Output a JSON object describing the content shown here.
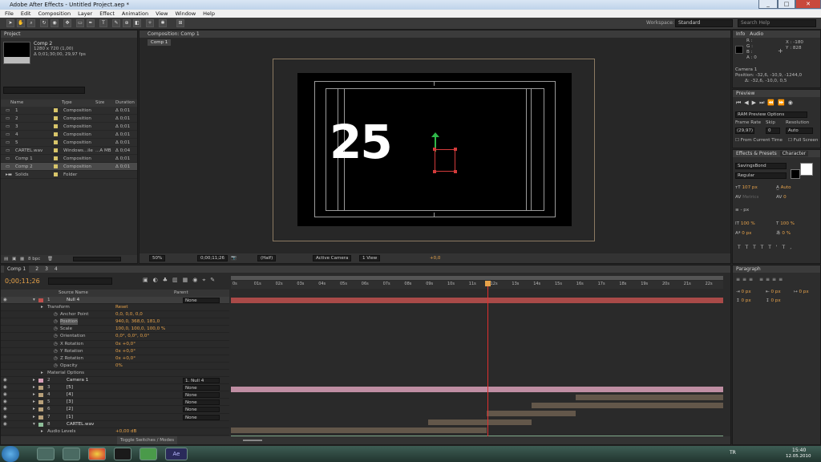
{
  "titlebar": {
    "title": "Adobe After Effects - Untitled Project.aep *"
  },
  "menu": [
    "File",
    "Edit",
    "Composition",
    "Layer",
    "Effect",
    "Animation",
    "View",
    "Window",
    "Help"
  ],
  "toolbar": {
    "workspace_label": "Workspace:",
    "workspace_value": "Standard",
    "search_placeholder": "Search Help"
  },
  "project": {
    "tab": "Project",
    "comp_name": "Comp 2",
    "comp_info_1": "1280 x 720 (1,00)",
    "comp_info_2": "Δ 0;01;30;00, 29,97 fps",
    "headers": [
      "Name",
      "Type",
      "Size",
      "Duration"
    ],
    "items": [
      {
        "name": "1",
        "type": "Composition",
        "size": "",
        "duration": "Δ 0;01"
      },
      {
        "name": "2",
        "type": "Composition",
        "size": "",
        "duration": "Δ 0;01"
      },
      {
        "name": "3",
        "type": "Composition",
        "size": "",
        "duration": "Δ 0;01"
      },
      {
        "name": "4",
        "type": "Composition",
        "size": "",
        "duration": "Δ 0;01"
      },
      {
        "name": "5",
        "type": "Composition",
        "size": "",
        "duration": "Δ 0;01"
      },
      {
        "name": "CARTEL.wav",
        "type": "Windows...ile",
        "size": "...A MB",
        "duration": "Δ 0;04"
      },
      {
        "name": "Comp 1",
        "type": "Composition",
        "size": "",
        "duration": "Δ 0;01"
      },
      {
        "name": "Comp 2",
        "type": "Composition",
        "size": "",
        "duration": "Δ 0;01"
      },
      {
        "name": "Solids",
        "type": "Folder",
        "size": "",
        "duration": ""
      }
    ],
    "bpc": "8 bpc"
  },
  "comp": {
    "tab": "Composition: Comp 1",
    "subtab": "Comp 1",
    "number_text": "25",
    "zoom": "50%",
    "time": "0;00;11;26",
    "resolution": "(Half)",
    "camera": "Active Camera",
    "views": "1 View",
    "exposure": "+0,0"
  },
  "info": {
    "tab1": "Info",
    "tab2": "Audio",
    "r": "R :",
    "g": "G :",
    "b": "B :",
    "a": "A : 0",
    "x": "X : -180",
    "y": "Y : 828",
    "camera": "Camera 1",
    "position": "Position: -32,6, -10,9, -1244,0",
    "delta": "Δ: -32,6, -10,0, 0,5"
  },
  "preview": {
    "tab": "Preview",
    "ram": "RAM Preview Options",
    "frame_rate_label": "Frame Rate",
    "skip_label": "Skip",
    "resolution_label": "Resolution",
    "frame_rate": "(29,97)",
    "skip": "0",
    "resolution": "Auto",
    "from_current": "From Current Time",
    "full_screen": "Full Screen"
  },
  "character": {
    "tab1": "Effects & Presets",
    "tab2": "Character",
    "font": "SavingsBond",
    "style": "Regular",
    "size": "107 px",
    "leading": "Auto",
    "kerning": "Metrics",
    "tracking": "0",
    "stroke": "- px",
    "vscale": "100 %",
    "hscale": "100 %",
    "baseline": "0 px",
    "tsume": "0 %"
  },
  "paragraph": {
    "tab": "Paragraph",
    "indent1": "0 px",
    "indent2": "0 px",
    "indent3": "0 px",
    "space1": "0 px",
    "space2": "0 px"
  },
  "timeline": {
    "tabs": [
      "Comp 1",
      "2",
      "3",
      "4"
    ],
    "time": "0;00;11;26",
    "ruler": [
      "0s",
      "01s",
      "02s",
      "03s",
      "04s",
      "05s",
      "06s",
      "07s",
      "08s",
      "09s",
      "10s",
      "11s",
      "12s",
      "13s",
      "14s",
      "15s",
      "16s",
      "17s",
      "18s",
      "19s",
      "20s",
      "21s",
      "22s"
    ],
    "col_source": "Source Name",
    "col_parent": "Parent",
    "layers": [
      {
        "num": "1",
        "name": "Null 4",
        "parent": "None",
        "color": "#c0504d"
      },
      {
        "prop": "Transform",
        "value": "Reset"
      },
      {
        "prop": "Anchor Point",
        "value": "0,0, 0,0, 0,0"
      },
      {
        "prop": "Position",
        "value": "940,0, 368,0, 181,0"
      },
      {
        "prop": "Scale",
        "value": "100,0, 100,0, 100,0 %"
      },
      {
        "prop": "Orientation",
        "value": "0,0°, 0,0°, 0,0°"
      },
      {
        "prop": "X Rotation",
        "value": "0x +0,0°"
      },
      {
        "prop": "Y Rotation",
        "value": "0x +0,0°"
      },
      {
        "prop": "Z Rotation",
        "value": "0x +0,0°"
      },
      {
        "prop": "Opacity",
        "value": "0%"
      },
      {
        "prop": "Material Options",
        "value": ""
      },
      {
        "num": "2",
        "name": "Camera 1",
        "parent": "1. Null 4",
        "color": "#d9a0b8"
      },
      {
        "num": "3",
        "name": "[5]",
        "parent": "None",
        "color": "#b8a07a"
      },
      {
        "num": "4",
        "name": "[4]",
        "parent": "None",
        "color": "#b8a07a"
      },
      {
        "num": "5",
        "name": "[3]",
        "parent": "None",
        "color": "#b8a07a"
      },
      {
        "num": "6",
        "name": "[2]",
        "parent": "None",
        "color": "#b8a07a"
      },
      {
        "num": "7",
        "name": "[1]",
        "parent": "None",
        "color": "#b8a07a"
      },
      {
        "num": "8",
        "name": "CARTEL.wav",
        "parent": "",
        "color": "#8fbf9a"
      },
      {
        "prop": "Audio Levels",
        "value": "+0,00 dB"
      }
    ],
    "toggle": "Toggle Switches / Modes"
  },
  "taskbar": {
    "lang": "TR",
    "time": "15:40",
    "date": "12.05.2010"
  },
  "colors": {
    "accent": "#e6a24a",
    "null_bar": "#c0504d",
    "camera_bar": "#d9a0b8",
    "comp_bar": "#8a7660",
    "audio_bar": "#8fbf9a"
  }
}
